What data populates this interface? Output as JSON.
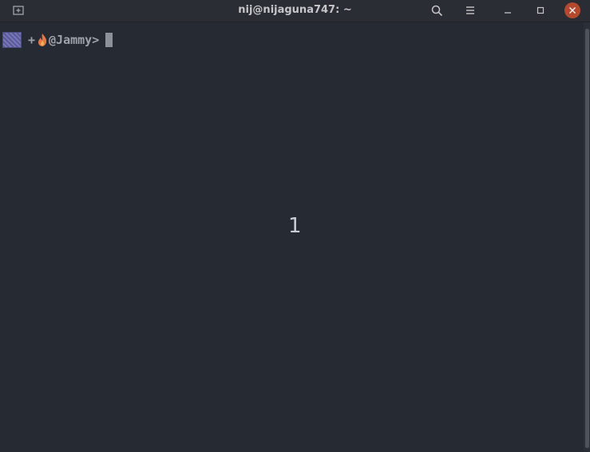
{
  "window": {
    "title": "nij@nijaguna747: ~"
  },
  "titlebar": {
    "icons": [
      "new-tab-icon",
      "search-icon",
      "hamburger-menu-icon",
      "minimize-icon",
      "maximize-icon",
      "close-icon"
    ]
  },
  "terminal": {
    "prompt_plus": "+",
    "prompt_user": "@Jammy>",
    "counter": "1"
  },
  "colors": {
    "background": "#262a33",
    "titlebar": "#2a2d33",
    "close_button": "#b34a2f"
  }
}
